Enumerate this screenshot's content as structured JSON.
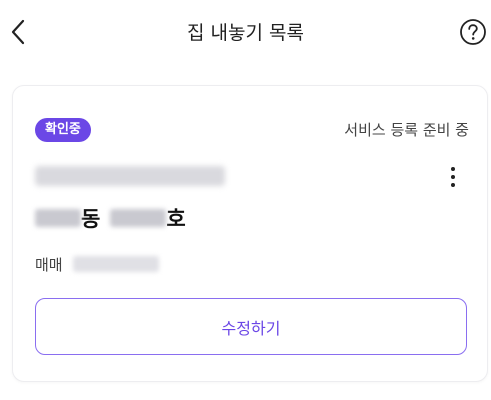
{
  "header": {
    "title": "집 내놓기 목록",
    "back_icon": "chevron-left-icon",
    "help_icon": "question-circle-icon"
  },
  "listing": {
    "badge": "확인중",
    "status": "서비스 등록 준비 중",
    "unit_dong_suffix": "동",
    "unit_ho_suffix": "호",
    "trade_type": "매매",
    "edit_button_label": "수정하기",
    "menu_icon": "kebab-menu-icon"
  },
  "colors": {
    "accent": "#6b47e6",
    "accent_border": "#8a6ef0",
    "text": "#222222",
    "muted_text": "#444444",
    "card_border": "#ededf0"
  }
}
